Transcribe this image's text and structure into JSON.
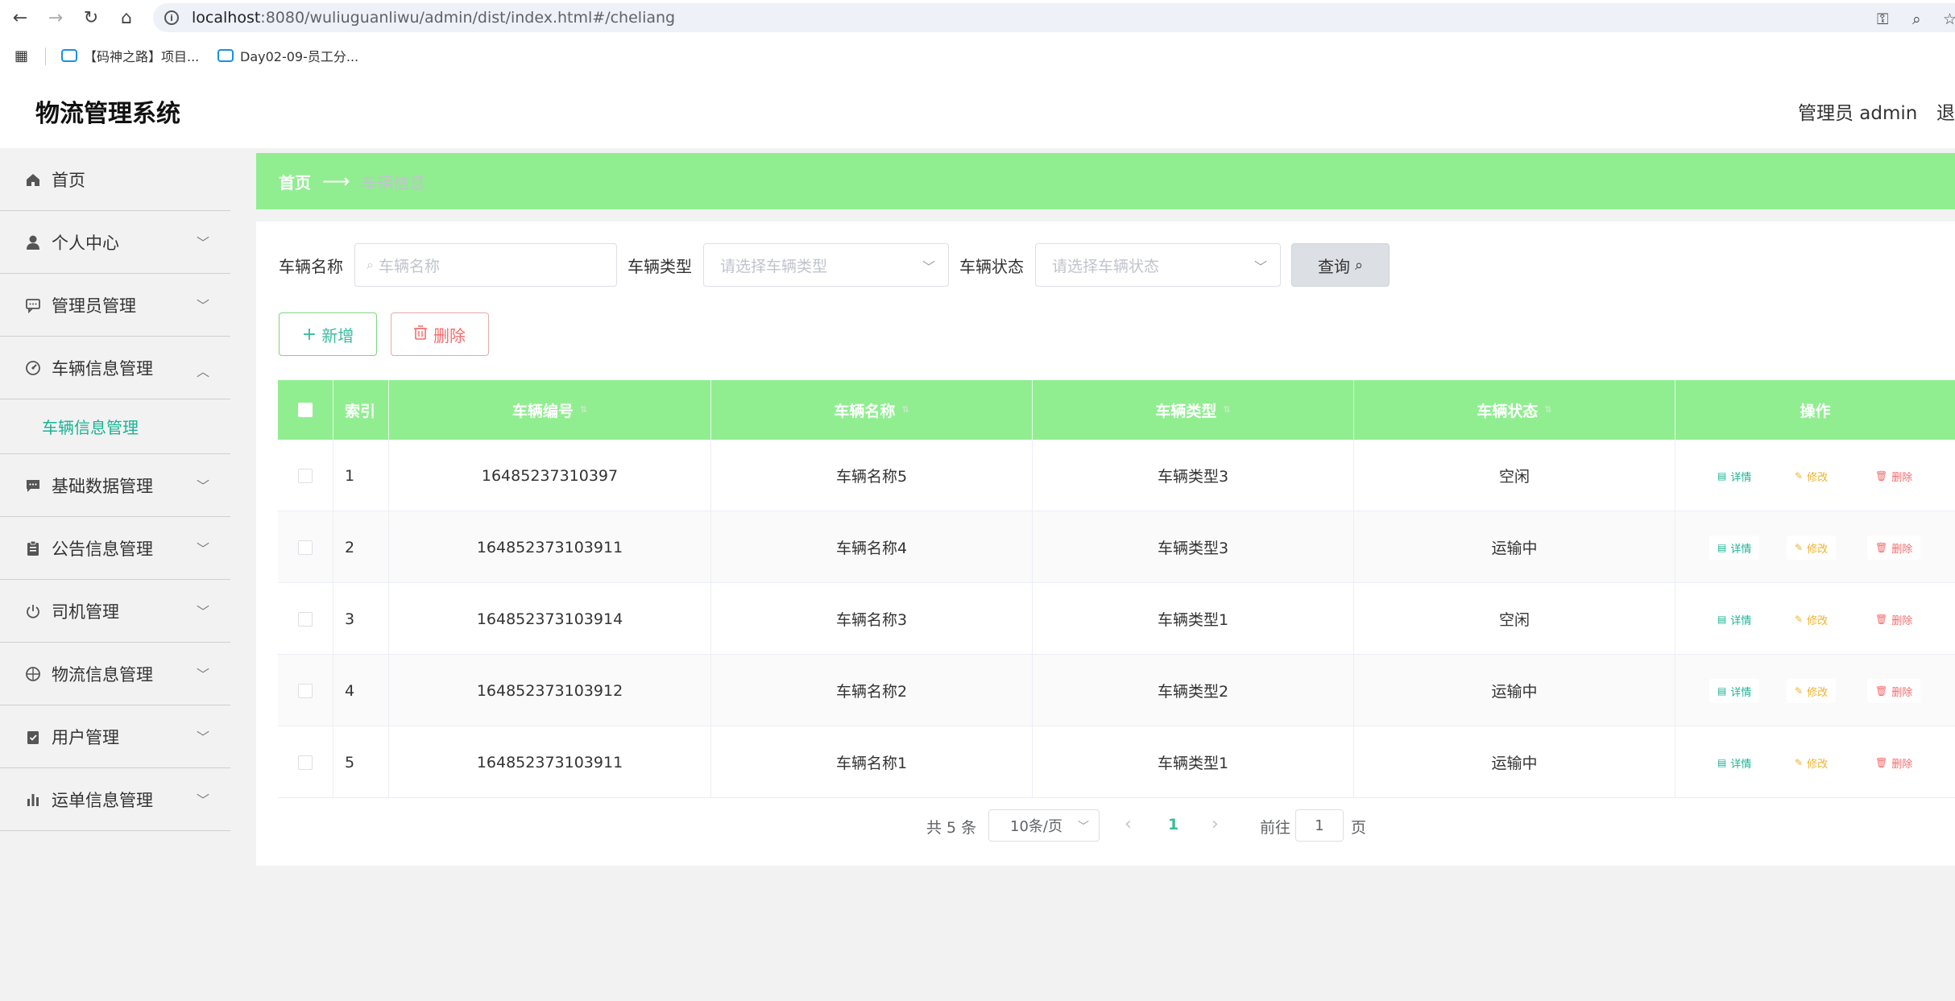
{
  "browser": {
    "url_host": "localhost",
    "url_rest": ":8080/wuliuguanliwu/admin/dist/index.html#/cheliang",
    "bookmarks": [
      "【码神之路】项目...",
      "Day02-09-员工分..."
    ]
  },
  "header": {
    "title": "物流管理系统",
    "admin": "管理员 admin",
    "logout": "退"
  },
  "sidebar": {
    "items": [
      {
        "label": "首页",
        "icon": "home-icon"
      },
      {
        "label": "个人中心",
        "icon": "user-icon"
      },
      {
        "label": "管理员管理",
        "icon": "chat-icon"
      },
      {
        "label": "车辆信息管理",
        "icon": "gauge-icon",
        "expanded": true
      },
      {
        "label": "基础数据管理",
        "icon": "message-icon"
      },
      {
        "label": "公告信息管理",
        "icon": "clipboard-icon"
      },
      {
        "label": "司机管理",
        "icon": "power-icon"
      },
      {
        "label": "物流信息管理",
        "icon": "compass-icon"
      },
      {
        "label": "用户管理",
        "icon": "checklist-icon"
      },
      {
        "label": "运单信息管理",
        "icon": "bar-chart-icon"
      }
    ],
    "sub_item": "车辆信息管理"
  },
  "breadcrumb": {
    "home": "首页",
    "current": "车辆信息"
  },
  "filters": {
    "name_label": "车辆名称",
    "name_placeholder": "车辆名称",
    "type_label": "车辆类型",
    "type_placeholder": "请选择车辆类型",
    "status_label": "车辆状态",
    "status_placeholder": "请选择车辆状态",
    "query": "查询"
  },
  "actions": {
    "add": "新增",
    "delete": "删除"
  },
  "table": {
    "headers": [
      "索引",
      "车辆编号",
      "车辆名称",
      "车辆类型",
      "车辆状态",
      "操作"
    ],
    "rows": [
      {
        "index": "1",
        "code": "16485237310397",
        "name": "车辆名称5",
        "type": "车辆类型3",
        "status": "空闲"
      },
      {
        "index": "2",
        "code": "164852373103911",
        "name": "车辆名称4",
        "type": "车辆类型3",
        "status": "运输中"
      },
      {
        "index": "3",
        "code": "164852373103914",
        "name": "车辆名称3",
        "type": "车辆类型1",
        "status": "空闲"
      },
      {
        "index": "4",
        "code": "164852373103912",
        "name": "车辆名称2",
        "type": "车辆类型2",
        "status": "运输中"
      },
      {
        "index": "5",
        "code": "164852373103911",
        "name": "车辆名称1",
        "type": "车辆类型1",
        "status": "运输中"
      }
    ],
    "row_actions": {
      "detail": "详情",
      "edit": "修改",
      "remove": "删除"
    }
  },
  "pagination": {
    "total": "共 5 条",
    "page_size": "10条/页",
    "current_page": "1",
    "goto_label": "前往",
    "goto_value": "1",
    "unit": "页"
  },
  "colors": {
    "accent_green": "#90ee90",
    "teal": "#1bb394",
    "danger": "#f56c6c",
    "warning": "#f0b22d"
  }
}
